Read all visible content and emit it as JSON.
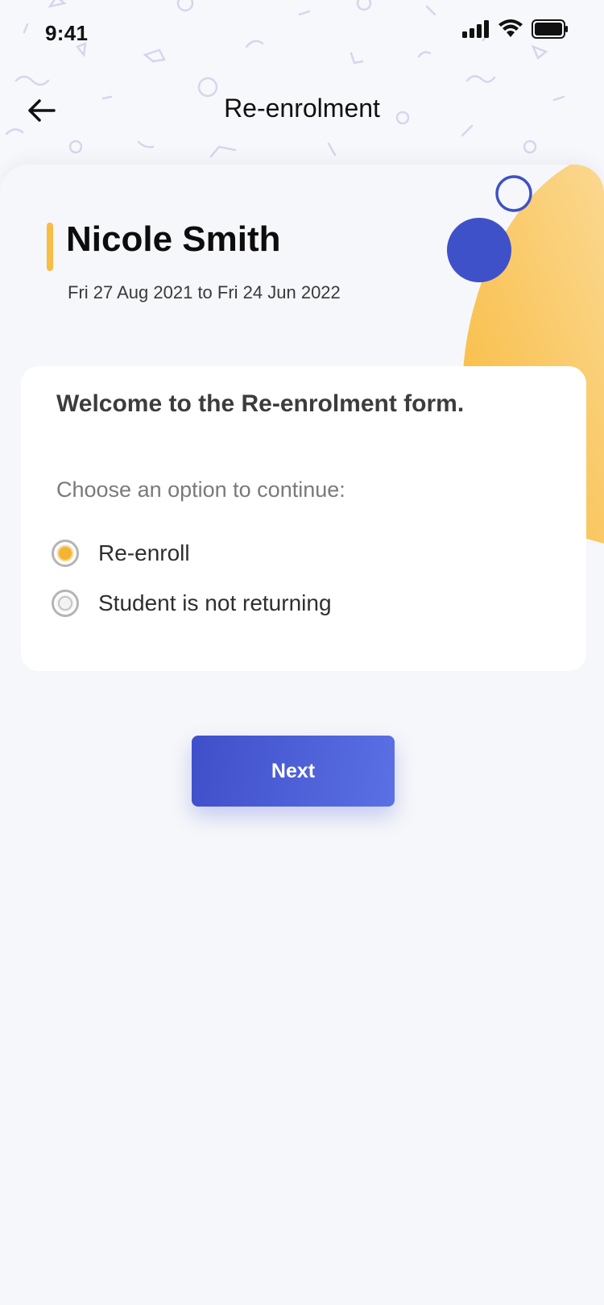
{
  "status_bar": {
    "time": "9:41",
    "icons": [
      "signal-icon",
      "wifi-icon",
      "battery-icon"
    ]
  },
  "header": {
    "back_icon": "arrow-left-icon",
    "title": "Re-enrolment"
  },
  "student": {
    "name": "Nicole Smith",
    "date_range": "Fri 27 Aug 2021 to Fri 24 Jun 2022"
  },
  "form": {
    "heading": "Welcome to the Re-enrolment form.",
    "prompt": "Choose an option to continue:",
    "options": [
      {
        "label": "Re-enroll",
        "selected": true
      },
      {
        "label": "Student is not returning",
        "selected": false
      }
    ]
  },
  "actions": {
    "next_label": "Next"
  },
  "colors": {
    "accent_yellow": "#f8bd45",
    "primary_blue": "#4556d3",
    "background": "#f7f8fb"
  }
}
